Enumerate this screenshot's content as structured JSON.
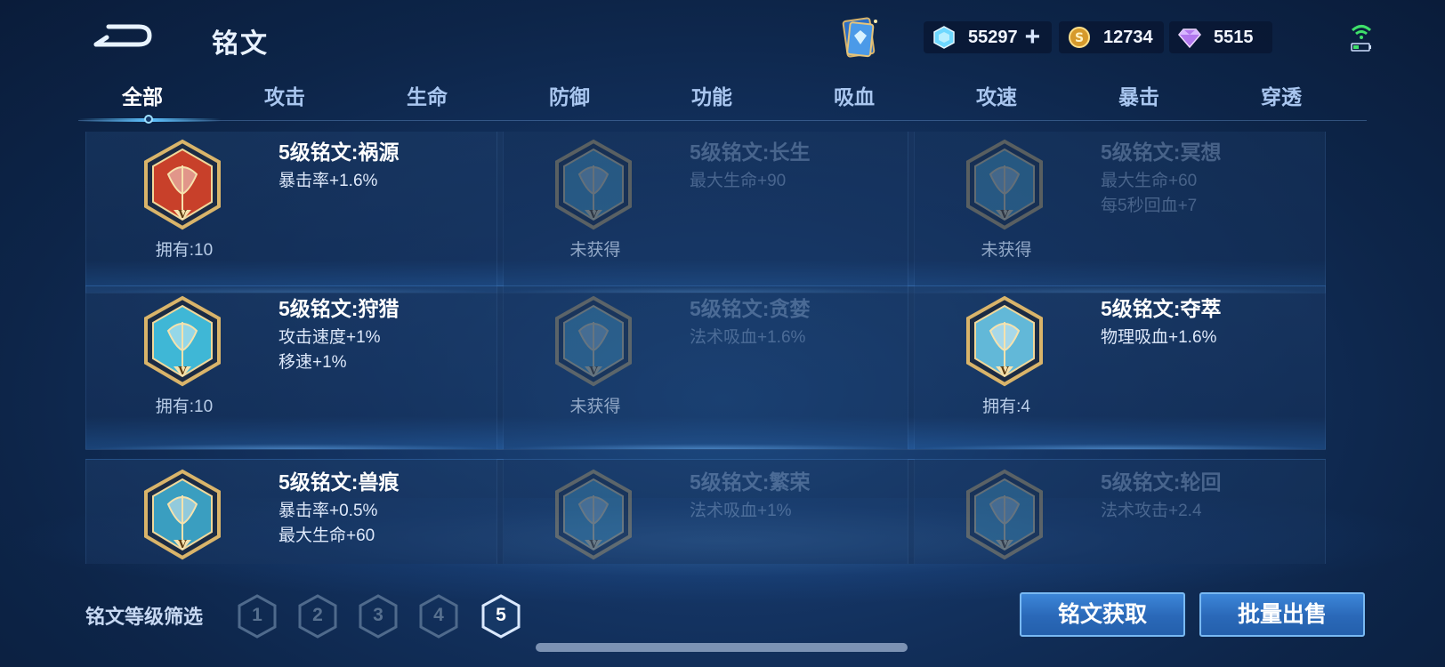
{
  "header": {
    "title": "铭文",
    "currencies": [
      {
        "icon": "blue-crystal-icon",
        "value": "55297",
        "has_plus": true
      },
      {
        "icon": "gold-coin-icon",
        "value": "12734"
      },
      {
        "icon": "purple-diamond-icon",
        "value": "5515"
      }
    ]
  },
  "tabs": [
    "全部",
    "攻击",
    "生命",
    "防御",
    "功能",
    "吸血",
    "攻速",
    "暴击",
    "穿透"
  ],
  "active_tab": "全部",
  "cards": [
    {
      "name": "5级铭文:祸源",
      "attrs": [
        "暴击率+1.6%"
      ],
      "owned": "拥有:10",
      "obtained": true,
      "color": "#c8402a"
    },
    {
      "name": "5级铭文:长生",
      "attrs": [
        "最大生命+90"
      ],
      "owned": "未获得",
      "obtained": false,
      "color": "#4aa0c8"
    },
    {
      "name": "5级铭文:冥想",
      "attrs": [
        "最大生命+60",
        "每5秒回血+7"
      ],
      "owned": "未获得",
      "obtained": false,
      "color": "#4aa0c8"
    },
    {
      "name": "5级铭文:狩猎",
      "attrs": [
        "攻击速度+1%",
        "移速+1%"
      ],
      "owned": "拥有:10",
      "obtained": true,
      "color": "#3fb7d6"
    },
    {
      "name": "5级铭文:贪婪",
      "attrs": [
        "法术吸血+1.6%"
      ],
      "owned": "未获得",
      "obtained": false,
      "color": "#4aa0c8"
    },
    {
      "name": "5级铭文:夺萃",
      "attrs": [
        "物理吸血+1.6%"
      ],
      "owned": "拥有:4",
      "obtained": true,
      "color": "#62b8d8"
    },
    {
      "name": "5级铭文:兽痕",
      "attrs": [
        "暴击率+0.5%",
        "最大生命+60"
      ],
      "owned": "",
      "obtained": true,
      "color": "#3a9ec0"
    },
    {
      "name": "5级铭文:繁荣",
      "attrs": [
        "法术吸血+1%"
      ],
      "owned": "",
      "obtained": false,
      "color": "#4aa0c8"
    },
    {
      "name": "5级铭文:轮回",
      "attrs": [
        "法术攻击+2.4"
      ],
      "owned": "",
      "obtained": false,
      "color": "#4aa0c8"
    }
  ],
  "filter": {
    "label": "铭文等级筛选",
    "levels": [
      "1",
      "2",
      "3",
      "4",
      "5"
    ],
    "active_level": "5"
  },
  "buttons": {
    "acquire": "铭文获取",
    "bulk_sell": "批量出售"
  },
  "colors": {
    "accent": "#5fc3ff",
    "button": "#2a68b8",
    "gold": "#d9b46a"
  }
}
